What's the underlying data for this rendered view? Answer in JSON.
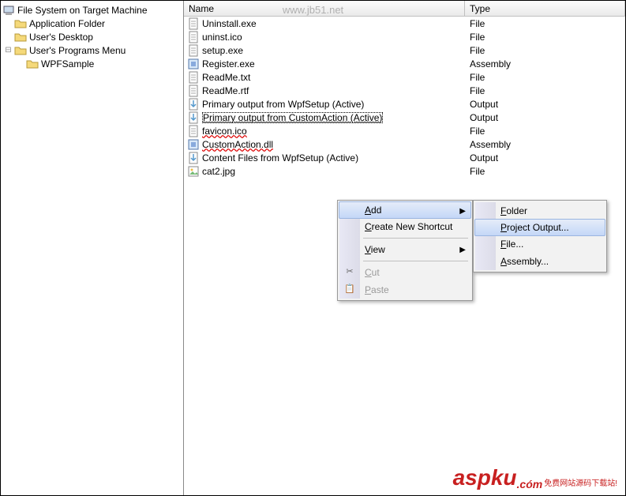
{
  "watermark": "www.jb51.net",
  "tree": {
    "root": "File System on Target Machine",
    "nodes": [
      {
        "label": "Application Folder",
        "depth": 1,
        "kind": "folder",
        "exp": false
      },
      {
        "label": "User's Desktop",
        "depth": 1,
        "kind": "folder",
        "exp": false
      },
      {
        "label": "User's Programs Menu",
        "depth": 1,
        "kind": "folder",
        "exp": true
      },
      {
        "label": "WPFSample",
        "depth": 2,
        "kind": "folder",
        "exp": false
      }
    ]
  },
  "columns": {
    "name": "Name",
    "type": "Type"
  },
  "files": [
    {
      "name": "Uninstall.exe",
      "type": "File",
      "icon": "doc"
    },
    {
      "name": "uninst.ico",
      "type": "File",
      "icon": "doc"
    },
    {
      "name": "setup.exe",
      "type": "File",
      "icon": "doc"
    },
    {
      "name": "Register.exe",
      "type": "Assembly",
      "icon": "asm"
    },
    {
      "name": "ReadMe.txt",
      "type": "File",
      "icon": "doc"
    },
    {
      "name": "ReadMe.rtf",
      "type": "File",
      "icon": "doc"
    },
    {
      "name": "Primary output from WpfSetup (Active)",
      "type": "Output",
      "icon": "out"
    },
    {
      "name": "Primary output from CustomAction (Active)",
      "type": "Output",
      "icon": "out",
      "selected": true
    },
    {
      "name": "favicon.ico",
      "type": "File",
      "icon": "doc",
      "wavy": true
    },
    {
      "name": "CustomAction.dll",
      "type": "Assembly",
      "icon": "asm",
      "wavy": true
    },
    {
      "name": "Content Files from WpfSetup (Active)",
      "type": "Output",
      "icon": "out"
    },
    {
      "name": "cat2.jpg",
      "type": "File",
      "icon": "img"
    }
  ],
  "contextMenu": {
    "items": [
      {
        "label": "Add",
        "arrow": true,
        "highlighted": true
      },
      {
        "label": "Create New Shortcut"
      },
      {
        "sep": true
      },
      {
        "label": "View",
        "arrow": true
      },
      {
        "sep": true
      },
      {
        "label": "Cut",
        "disabled": true,
        "icon": "cut"
      },
      {
        "label": "Paste",
        "disabled": true,
        "icon": "paste"
      }
    ]
  },
  "subMenu": {
    "items": [
      {
        "label": "Folder"
      },
      {
        "label": "Project Output...",
        "highlighted": true
      },
      {
        "label": "File..."
      },
      {
        "label": "Assembly..."
      }
    ]
  },
  "logo": {
    "main": "aspku",
    "ext": ".cóm",
    "sub": "免费网站源码下载站!"
  }
}
